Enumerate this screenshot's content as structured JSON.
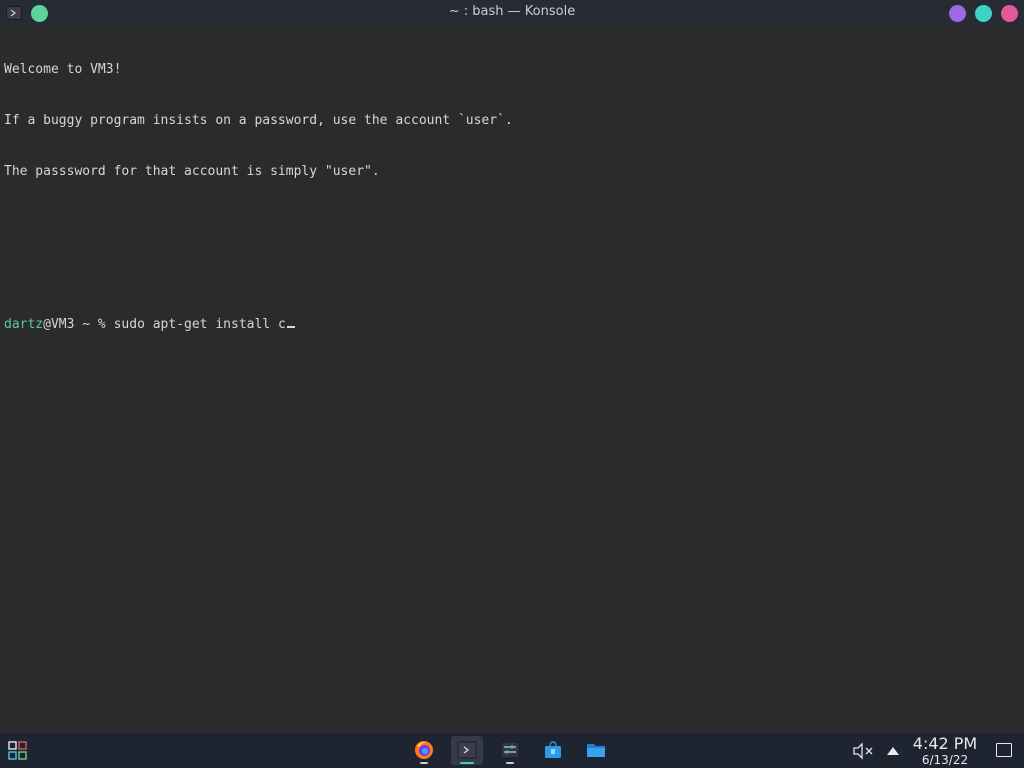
{
  "window": {
    "title": "~ : bash — Konsole",
    "app_icon": "terminal-icon",
    "buttons": {
      "pin": {
        "icon": "pin-icon",
        "color": "#5fd49a"
      },
      "minimize": {
        "icon": "minimize-icon",
        "color": "#9b6ae0"
      },
      "maximize": {
        "icon": "maximize-icon",
        "color": "#3ed3c4"
      },
      "close": {
        "icon": "close-icon",
        "color": "#e2589a"
      }
    }
  },
  "terminal": {
    "lines": [
      "Welcome to VM3!",
      "If a buggy program insists on a password, use the account `user`.",
      "The passsword for that account is simply \"user\".",
      "",
      ""
    ],
    "prompt": {
      "user_host": "dartz",
      "rest": "@VM3 ~ % ",
      "command": "sudo apt-get install c"
    },
    "colors": {
      "background": "#2b2b2b",
      "text": "#d6d6d6",
      "prompt_user": "#5fc89a"
    }
  },
  "taskbar": {
    "launcher_icon": "application-launcher-icon",
    "tasks": [
      {
        "name": "Firefox",
        "icon": "firefox-icon",
        "active": false
      },
      {
        "name": "Konsole",
        "icon": "terminal-icon",
        "active": true
      },
      {
        "name": "System Settings",
        "icon": "settings-sliders-icon",
        "active": false
      },
      {
        "name": "Discover",
        "icon": "store-bag-icon",
        "active": false
      },
      {
        "name": "Dolphin",
        "icon": "folder-icon",
        "active": false
      }
    ],
    "tray": {
      "volume_icon": "volume-muted-icon",
      "notifications_icon": "expand-tray-icon",
      "time": "4:42 PM",
      "date": "6/13/22",
      "show_desktop_icon": "show-desktop-icon"
    }
  }
}
